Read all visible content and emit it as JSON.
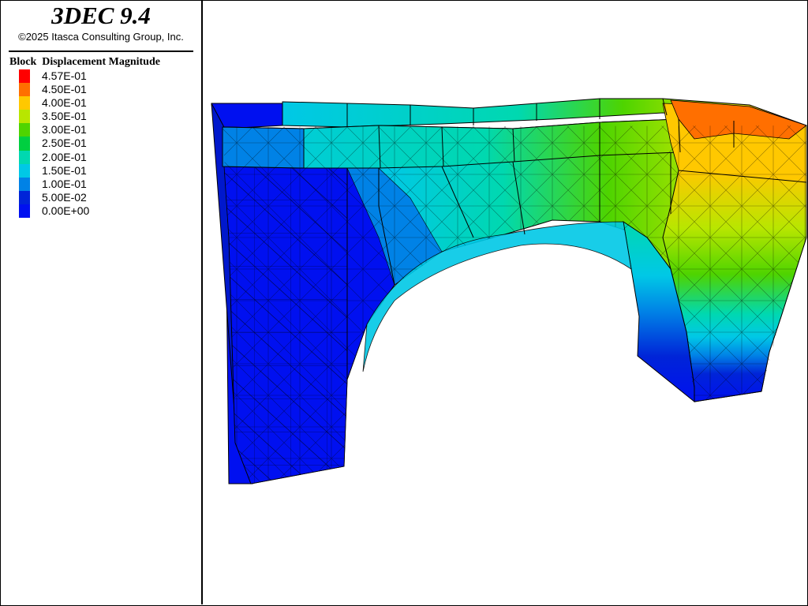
{
  "header": {
    "app_title": "3DEC 9.4",
    "copyright": "©2025 Itasca Consulting Group, Inc."
  },
  "legend": {
    "title": "Block  Displacement Magnitude",
    "items": [
      {
        "label": "4.57E-01",
        "color": "#ff0000"
      },
      {
        "label": "4.50E-01",
        "color": "#ff6f00"
      },
      {
        "label": "4.00E-01",
        "color": "#ffc800"
      },
      {
        "label": "3.50E-01",
        "color": "#b8e600"
      },
      {
        "label": "3.00E-01",
        "color": "#4ed400"
      },
      {
        "label": "2.50E-01",
        "color": "#00cf40"
      },
      {
        "label": "2.00E-01",
        "color": "#00d8b0"
      },
      {
        "label": "1.50E-01",
        "color": "#00c8e6"
      },
      {
        "label": "1.00E-01",
        "color": "#0082e6"
      },
      {
        "label": "5.00E-02",
        "color": "#0024d8"
      },
      {
        "label": "0.00E+00",
        "color": "#0010f0"
      }
    ]
  },
  "viewport": {
    "model": "arch-bridge-block-mesh",
    "contour_field": "Block Displacement Magnitude"
  }
}
